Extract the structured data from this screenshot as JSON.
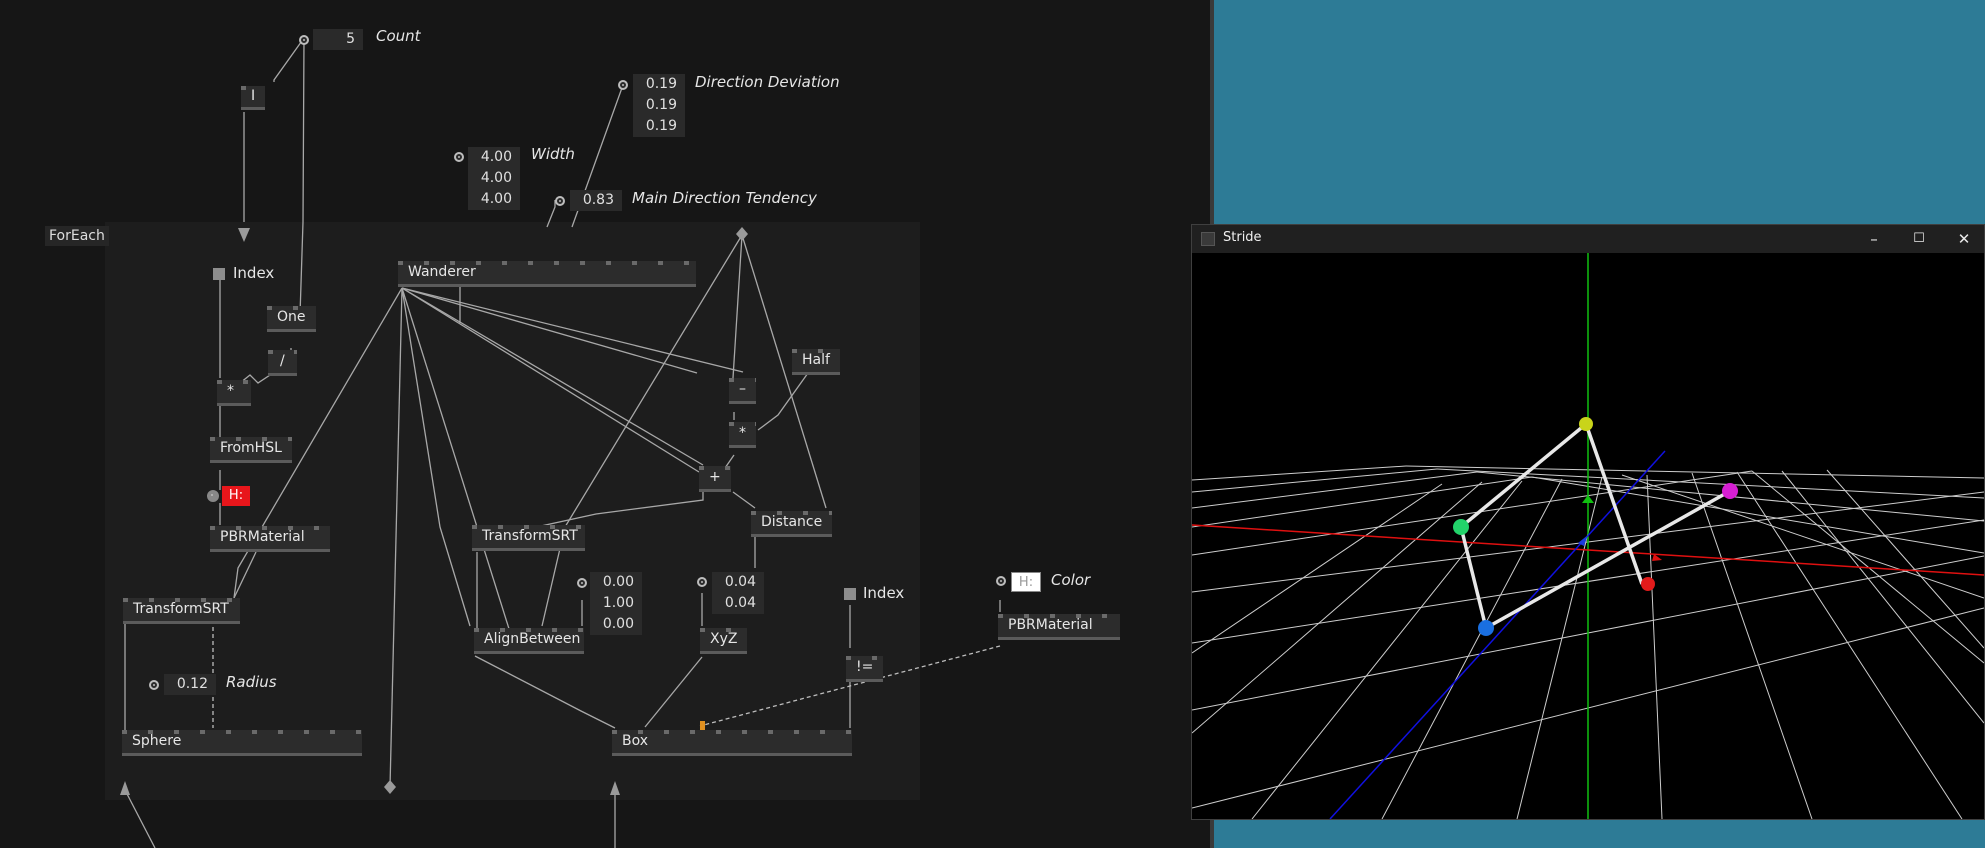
{
  "patch": {
    "region_label": "ForEach",
    "count": {
      "value": "5",
      "label": "Count"
    },
    "direction_deviation": {
      "values": [
        "0.19",
        "0.19",
        "0.19"
      ],
      "label": "Direction Deviation"
    },
    "width": {
      "values": [
        "4.00",
        "4.00",
        "4.00"
      ],
      "label": "Width"
    },
    "main_direction_tendency": {
      "value": "0.83",
      "label": "Main Direction Tendency"
    },
    "radius": {
      "value": "0.12",
      "label": "Radius"
    },
    "align_vector": {
      "values": [
        "0.00",
        "1.00",
        "0.00"
      ]
    },
    "xyz_input": {
      "values": [
        "0.04",
        "0.04"
      ]
    },
    "color": {
      "label": "Color",
      "swatch_text": "H:",
      "swatch_color": "#ffffff"
    },
    "hsl_swatch": {
      "text": "H:",
      "color": "#e8161b"
    },
    "index_labels": [
      "Index",
      "Index"
    ],
    "nodes": {
      "i": "I",
      "one": "One",
      "divide": "/",
      "multiply": "*",
      "from_hsl": "FromHSL",
      "pbr_material": "PBRMaterial",
      "transform_srt_left": "TransformSRT",
      "sphere": "Sphere",
      "wanderer": "Wanderer",
      "transform_srt_mid": "TransformSRT",
      "align_between": "AlignBetween",
      "minus": "–",
      "half": "Half",
      "multiply2": "*",
      "plus": "+",
      "distance": "Distance",
      "xyz": "XyZ",
      "not_equal": "!=",
      "box": "Box",
      "pbr_material_right": "PBRMaterial"
    }
  },
  "stride_window": {
    "title": "Stride",
    "minimize": "–",
    "maximize": "☐",
    "close": "✕"
  },
  "scene": {
    "background": "#000000",
    "grid_color": "#d8d8d8",
    "axis_colors": {
      "x": "#e01010",
      "y": "#10c010",
      "z": "#1010e0"
    },
    "point_colors": [
      "#22d36a",
      "#c9d41a",
      "#d61fd3",
      "#1a6fe0",
      "#e31b1b"
    ]
  },
  "colors": {
    "editor_bg": "#161616",
    "region_bg": "#1d1d1d",
    "right_panel": "#2d7b96",
    "node_bg": "#2c2c2c"
  }
}
